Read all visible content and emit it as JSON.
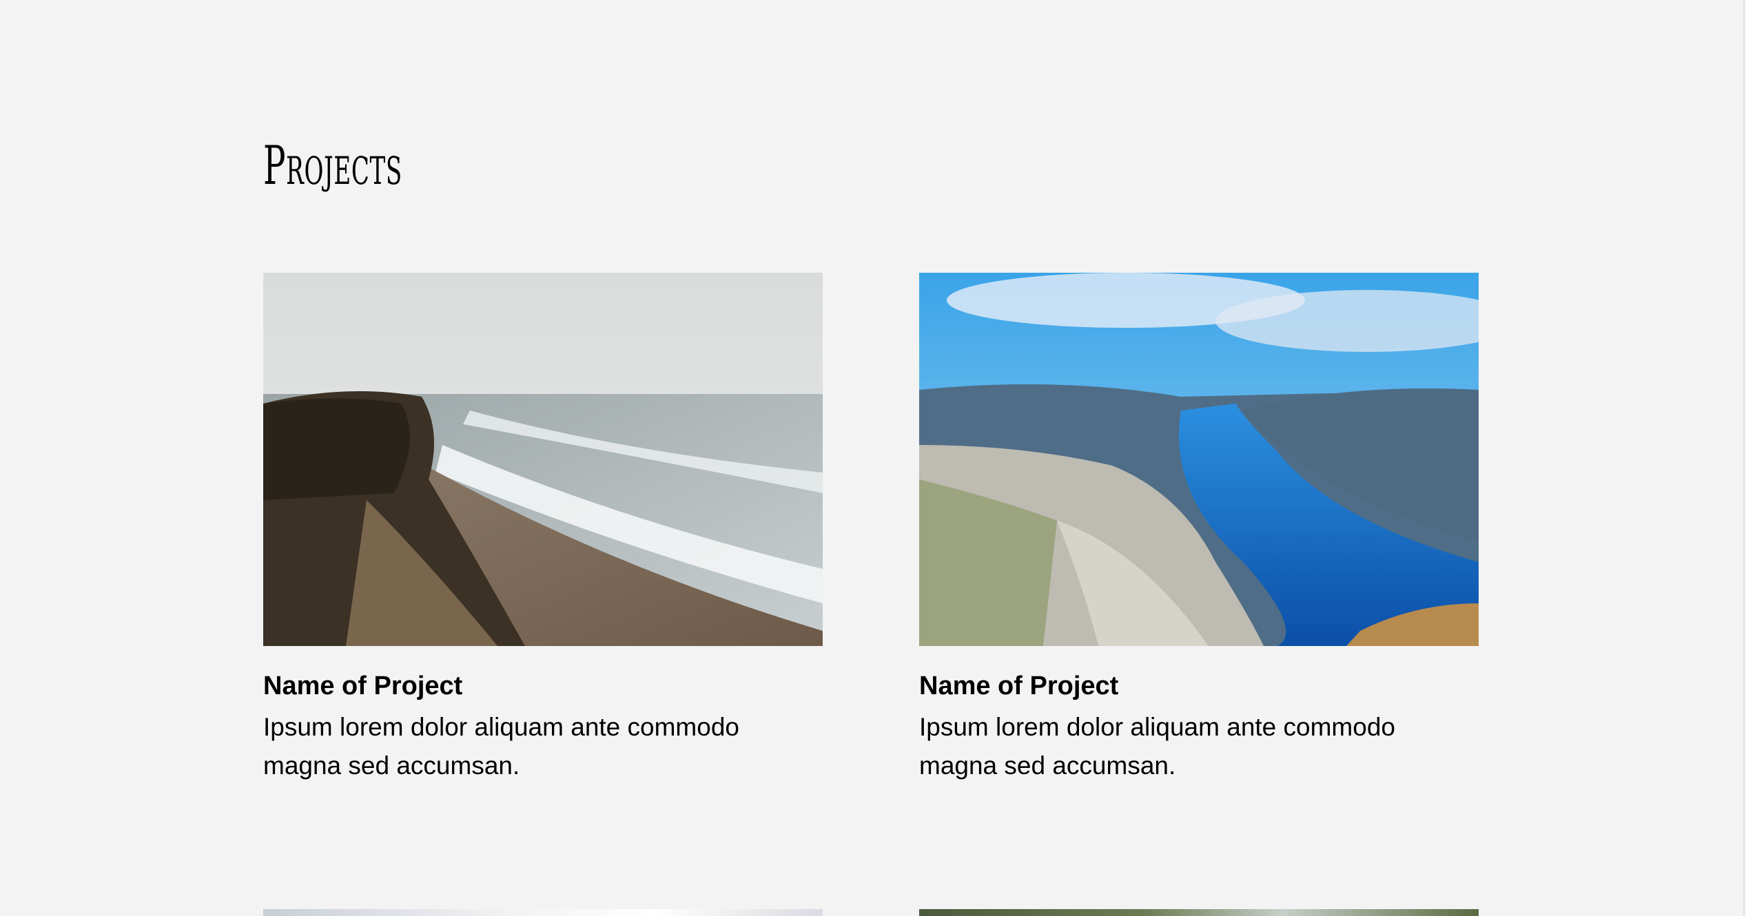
{
  "section": {
    "title": "Projects"
  },
  "projects": [
    {
      "name": "Name of Project",
      "description": "Ipsum lorem dolor aliquam ante commodo magna sed accumsan.",
      "image": "coastal-cliff-beach-photo"
    },
    {
      "name": "Name of Project",
      "description": "Ipsum lorem dolor aliquam ante commodo magna sed accumsan.",
      "image": "fjord-mountain-photo"
    }
  ],
  "colors": {
    "background": "#f3f3f3",
    "text": "#000000"
  }
}
